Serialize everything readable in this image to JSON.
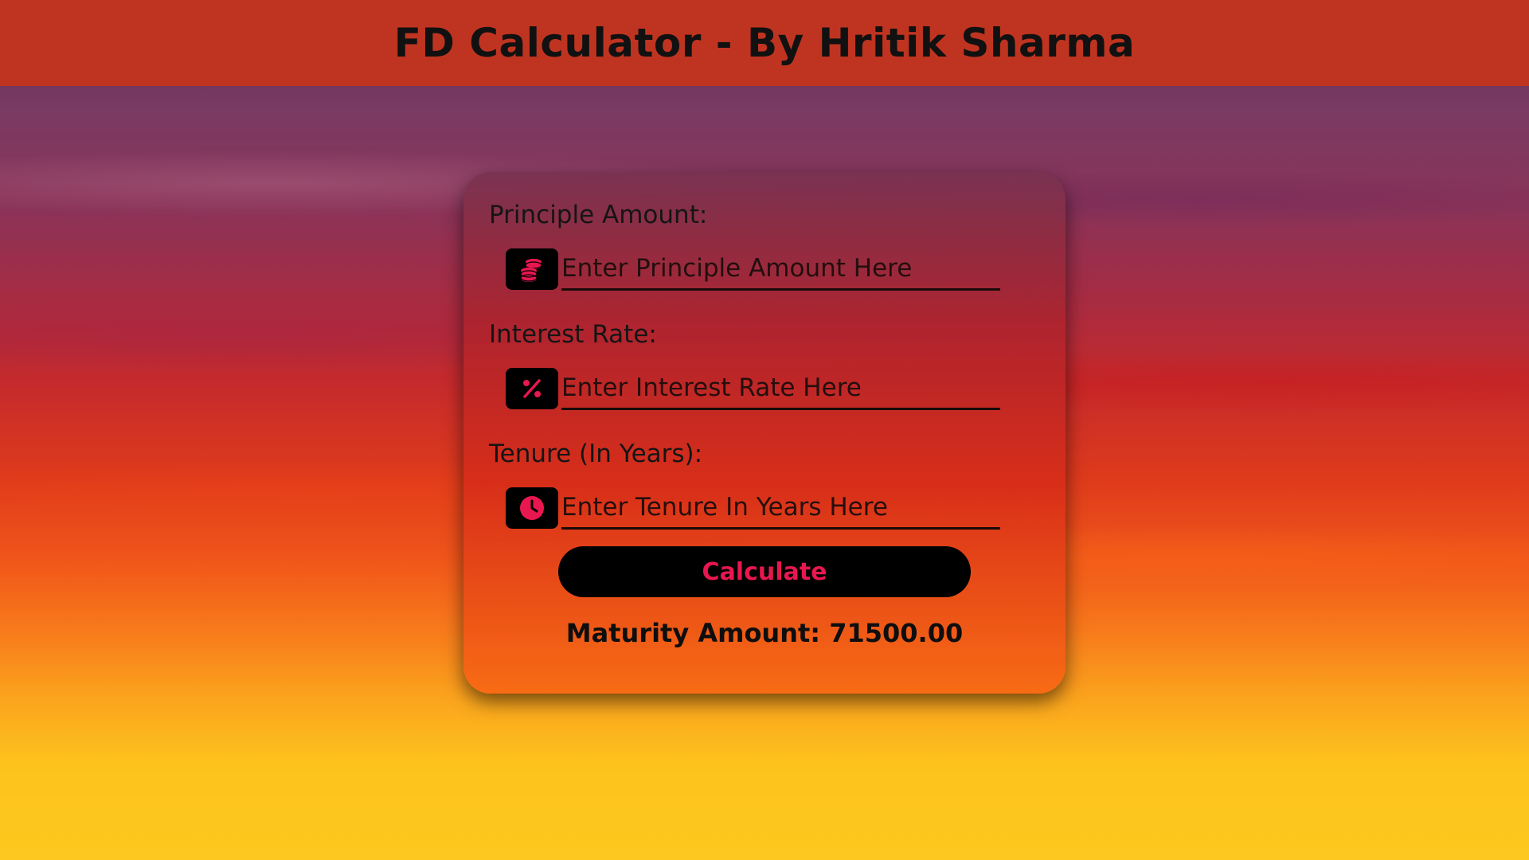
{
  "header": {
    "title": "FD Calculator - By Hritik Sharma"
  },
  "form": {
    "principal": {
      "label": "Principle Amount:",
      "placeholder": "Enter Principle Amount Here",
      "icon": "coins-icon"
    },
    "rate": {
      "label": "Interest Rate:",
      "placeholder": "Enter Interest Rate Here",
      "icon": "percent-icon"
    },
    "tenure": {
      "label": "Tenure (In Years):",
      "placeholder": "Enter Tenure In Years Here",
      "icon": "clock-icon"
    },
    "calculate_label": "Calculate",
    "result_text": "Maturity Amount: 71500.00"
  },
  "colors": {
    "header_bg": "#bf3420",
    "icon_accent": "#e8174f",
    "button_bg": "#000000"
  }
}
